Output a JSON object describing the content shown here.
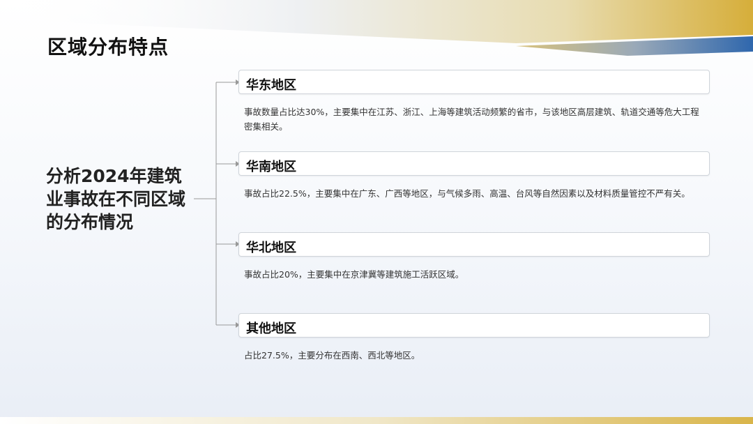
{
  "page": {
    "title": "区域分布特点"
  },
  "main_topic": "分析2024年建筑业事故在不同区域的分布情况",
  "regions": [
    {
      "name": "华东地区",
      "description": "事故数量占比达30%，主要集中在江苏、浙江、上海等建筑活动频繁的省市，与该地区高层建筑、轨道交通等危大工程密集相关。"
    },
    {
      "name": "华南地区",
      "description": "事故占比22.5%，主要集中在广东、广西等地区，与气候多雨、高温、台风等自然因素以及材料质量管控不严有关。"
    },
    {
      "name": "华北地区",
      "description": "事故占比20%，主要集中在京津冀等建筑施工活跃区域。"
    },
    {
      "name": "其他地区",
      "description": "占比27.5%，主要分布在西南、西北等地区。"
    }
  ],
  "colors": {
    "accent_gold": "#d9b54a",
    "accent_blue": "#3a6fae",
    "connector": "#888888"
  }
}
